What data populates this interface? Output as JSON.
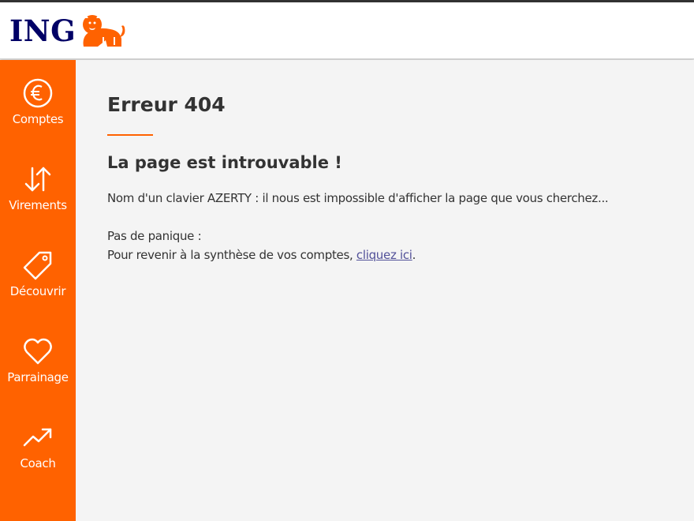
{
  "header": {
    "logo_text": "ING"
  },
  "sidebar": {
    "items": [
      {
        "label": "Comptes",
        "icon": "euro-icon"
      },
      {
        "label": "Virements",
        "icon": "transfer-arrows-icon"
      },
      {
        "label": "Découvrir",
        "icon": "tag-icon"
      },
      {
        "label": "Parrainage",
        "icon": "heart-icon"
      },
      {
        "label": "Coach",
        "icon": "trend-up-icon"
      }
    ]
  },
  "main": {
    "title": "Erreur 404",
    "subtitle": "La page est introuvable !",
    "message": "Nom d'un clavier AZERTY : il nous est impossible d'afficher la page que vous cherchez...",
    "panic": "Pas de panique :",
    "return_text": "Pour revenir à la synthèse de vos comptes, ",
    "return_link": "cliquez ici",
    "return_end": "."
  },
  "colors": {
    "accent": "#ff6200",
    "brand_blue": "#000066",
    "link": "#525199",
    "background": "#f4f4f4"
  }
}
